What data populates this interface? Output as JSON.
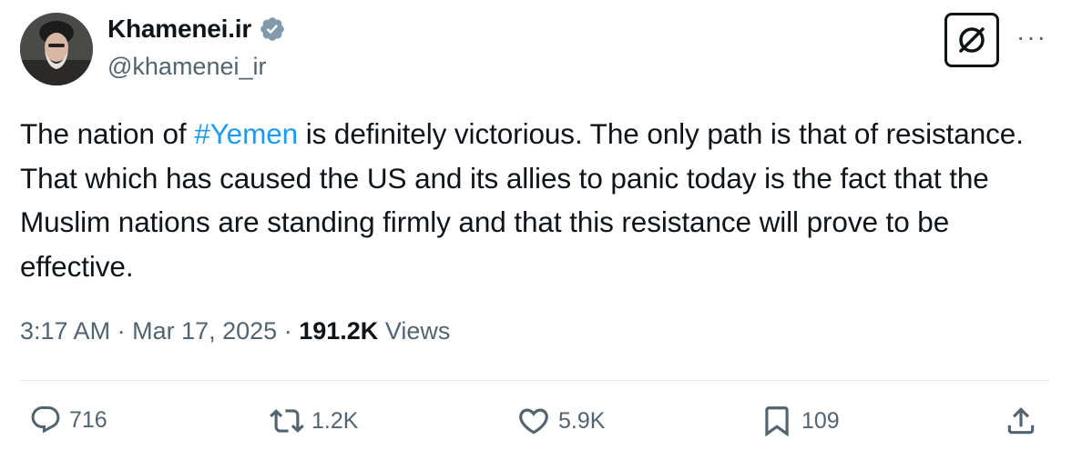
{
  "tweet": {
    "author": {
      "display_name": "Khamenei.ir",
      "handle": "@khamenei_ir",
      "verified_icon": "verified-badge-icon"
    },
    "text": {
      "before_hashtag": "The nation of ",
      "hashtag": "#Yemen",
      "after_hashtag": " is definitely victorious. The only path is that of resistance. That which has caused the US and its allies to panic today is the fact that the Muslim nations are standing firmly and that this resistance will prove to be effective."
    },
    "meta": {
      "time": "3:17 AM",
      "date": "Mar 17, 2025",
      "views_count": "191.2K",
      "views_label": "Views",
      "separator": "·"
    },
    "actions": {
      "replies": "716",
      "reposts": "1.2K",
      "likes": "5.9K",
      "bookmarks": "109"
    }
  },
  "toolbar": {
    "more_label": "···",
    "grok_icon": "grok-icon"
  },
  "colors": {
    "text": "#0f1419",
    "secondary": "#536471",
    "link": "#1d9bf0",
    "divider": "#e6e9ec",
    "verified": "#829aab"
  }
}
